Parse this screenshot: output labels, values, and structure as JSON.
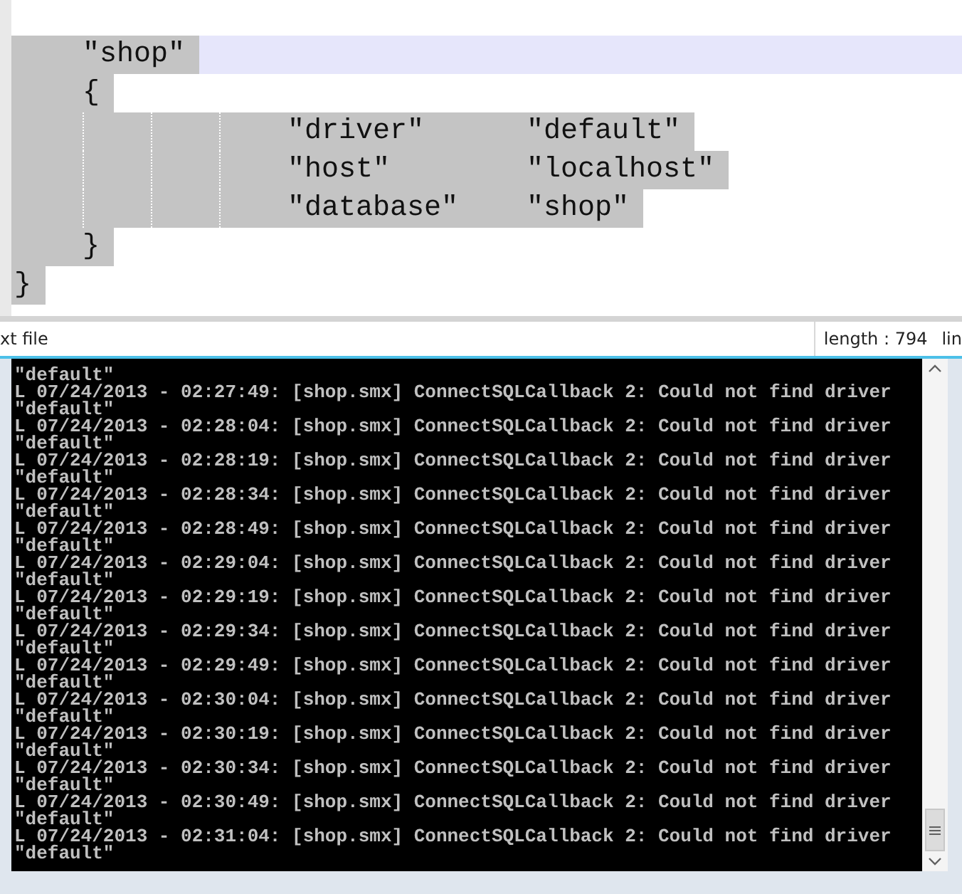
{
  "editor": {
    "selected": true,
    "block": {
      "name": "\"shop\"",
      "current": true,
      "open": "{",
      "entries": [
        {
          "key": "\"driver\"",
          "value": "\"default\""
        },
        {
          "key": "\"host\"",
          "value": "\"localhost\""
        },
        {
          "key": "\"database\"",
          "value": "\"shop\""
        }
      ],
      "close": "}"
    },
    "close": "}"
  },
  "status_bar": {
    "file_type": "xt file",
    "length": "length : 794",
    "column_3": "lin"
  },
  "console": {
    "lines": [
      "\"default\"",
      "L 07/24/2013 - 02:27:49: [shop.smx] ConnectSQLCallback 2: Could not find driver",
      "\"default\"",
      "L 07/24/2013 - 02:28:04: [shop.smx] ConnectSQLCallback 2: Could not find driver",
      "\"default\"",
      "L 07/24/2013 - 02:28:19: [shop.smx] ConnectSQLCallback 2: Could not find driver",
      "\"default\"",
      "L 07/24/2013 - 02:28:34: [shop.smx] ConnectSQLCallback 2: Could not find driver",
      "\"default\"",
      "L 07/24/2013 - 02:28:49: [shop.smx] ConnectSQLCallback 2: Could not find driver",
      "\"default\"",
      "L 07/24/2013 - 02:29:04: [shop.smx] ConnectSQLCallback 2: Could not find driver",
      "\"default\"",
      "L 07/24/2013 - 02:29:19: [shop.smx] ConnectSQLCallback 2: Could not find driver",
      "\"default\"",
      "L 07/24/2013 - 02:29:34: [shop.smx] ConnectSQLCallback 2: Could not find driver",
      "\"default\"",
      "L 07/24/2013 - 02:29:49: [shop.smx] ConnectSQLCallback 2: Could not find driver",
      "\"default\"",
      "L 07/24/2013 - 02:30:04: [shop.smx] ConnectSQLCallback 2: Could not find driver",
      "\"default\"",
      "L 07/24/2013 - 02:30:19: [shop.smx] ConnectSQLCallback 2: Could not find driver",
      "\"default\"",
      "L 07/24/2013 - 02:30:34: [shop.smx] ConnectSQLCallback 2: Could not find driver",
      "\"default\"",
      "L 07/24/2013 - 02:30:49: [shop.smx] ConnectSQLCallback 2: Could not find driver",
      "\"default\"",
      "L 07/24/2013 - 02:31:04: [shop.smx] ConnectSQLCallback 2: Could not find driver",
      "\"default\""
    ]
  }
}
